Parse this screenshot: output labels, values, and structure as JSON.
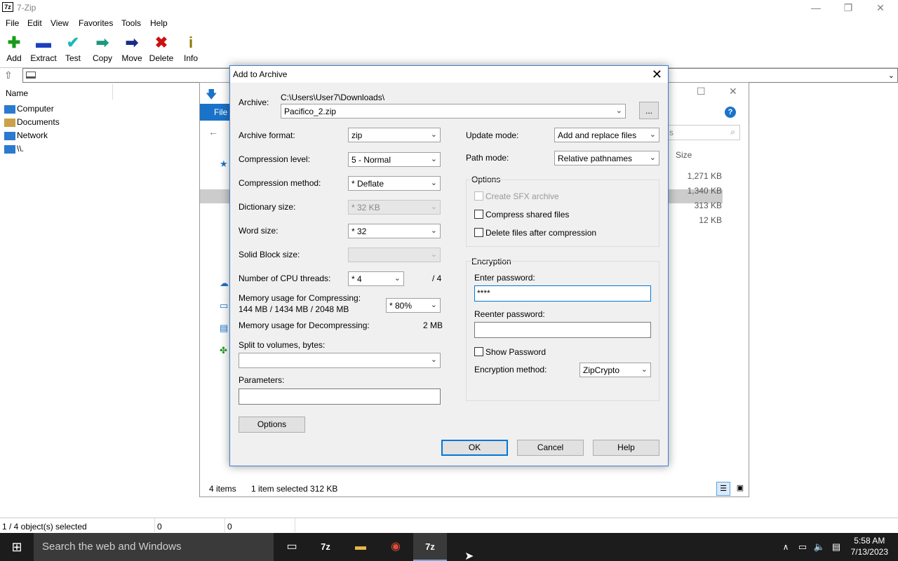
{
  "app": {
    "title": "7-Zip",
    "icon": "7z"
  },
  "menu": [
    "File",
    "Edit",
    "View",
    "Favorites",
    "Tools",
    "Help"
  ],
  "toolbar": [
    {
      "label": "Add",
      "icon": "plus-icon",
      "glyph": "✚",
      "color": "#1a9a1a"
    },
    {
      "label": "Extract",
      "icon": "minus-icon",
      "glyph": "▬",
      "color": "#1a3fbf"
    },
    {
      "label": "Test",
      "icon": "check-icon",
      "glyph": "✔",
      "color": "#1fb8b8"
    },
    {
      "label": "Copy",
      "icon": "copy-arrow-icon",
      "glyph": "➡",
      "color": "#1a9a7a"
    },
    {
      "label": "Move",
      "icon": "move-arrow-icon",
      "glyph": "➡",
      "color": "#1a2a8a"
    },
    {
      "label": "Delete",
      "icon": "delete-x-icon",
      "glyph": "✖",
      "color": "#cc1111"
    },
    {
      "label": "Info",
      "icon": "info-icon",
      "glyph": "i",
      "color": "#8a7a00"
    }
  ],
  "left_pane": {
    "header": "Name",
    "items": [
      {
        "label": "Computer",
        "icon": "computer-icon"
      },
      {
        "label": "Documents",
        "icon": "documents-icon"
      },
      {
        "label": "Network",
        "icon": "network-icon"
      },
      {
        "label": "\\\\.",
        "icon": "drive-icon"
      }
    ]
  },
  "status": {
    "selected": "1 / 4 object(s) selected",
    "v1": "0",
    "v2": "0"
  },
  "explorer": {
    "ribbon_tab": "File",
    "search_placeholder": "s",
    "col_size": "Size",
    "sizes": [
      "1,271 KB",
      "1,340 KB",
      "313 KB",
      "12 KB"
    ],
    "items_count": "4 items",
    "selection": "1 item selected  312 KB"
  },
  "dialog": {
    "title": "Add to Archive",
    "archive_label": "Archive:",
    "archive_path": "C:\\Users\\User7\\Downloads\\",
    "archive_name": "Pacifico_2.zip",
    "browse": "...",
    "fields": {
      "archive_format": {
        "label": "Archive format:",
        "value": "zip"
      },
      "compression_level": {
        "label": "Compression level:",
        "value": "5 - Normal"
      },
      "compression_method": {
        "label": "Compression method:",
        "value": "* Deflate"
      },
      "dictionary_size": {
        "label": "Dictionary size:",
        "value": "* 32 KB"
      },
      "word_size": {
        "label": "Word size:",
        "value": "* 32"
      },
      "solid_block": {
        "label": "Solid Block size:",
        "value": ""
      },
      "cpu_threads": {
        "label": "Number of CPU threads:",
        "value": "* 4",
        "max": "/ 4"
      },
      "mem_compress": {
        "label": "Memory usage for Compressing:",
        "detail": "144 MB / 1434 MB / 2048 MB",
        "value": "* 80%"
      },
      "mem_decompress": {
        "label": "Memory usage for Decompressing:",
        "value": "2 MB"
      },
      "split": {
        "label": "Split to volumes, bytes:",
        "value": ""
      },
      "parameters": {
        "label": "Parameters:",
        "value": ""
      }
    },
    "options_button": "Options",
    "update_mode": {
      "label": "Update mode:",
      "value": "Add and replace files"
    },
    "path_mode": {
      "label": "Path mode:",
      "value": "Relative pathnames"
    },
    "options_group": {
      "title": "Options",
      "sfx": "Create SFX archive",
      "shared": "Compress shared files",
      "delete_after": "Delete files after compression"
    },
    "encryption": {
      "title": "Encryption",
      "enter_label": "Enter password:",
      "enter_value": "****",
      "reenter_label": "Reenter password:",
      "reenter_value": "",
      "show_password": "Show Password",
      "method_label": "Encryption method:",
      "method_value": "ZipCrypto"
    },
    "buttons": {
      "ok": "OK",
      "cancel": "Cancel",
      "help": "Help"
    }
  },
  "taskbar": {
    "search": "Search the web and Windows",
    "time": "5:58 AM",
    "date": "7/13/2023"
  }
}
